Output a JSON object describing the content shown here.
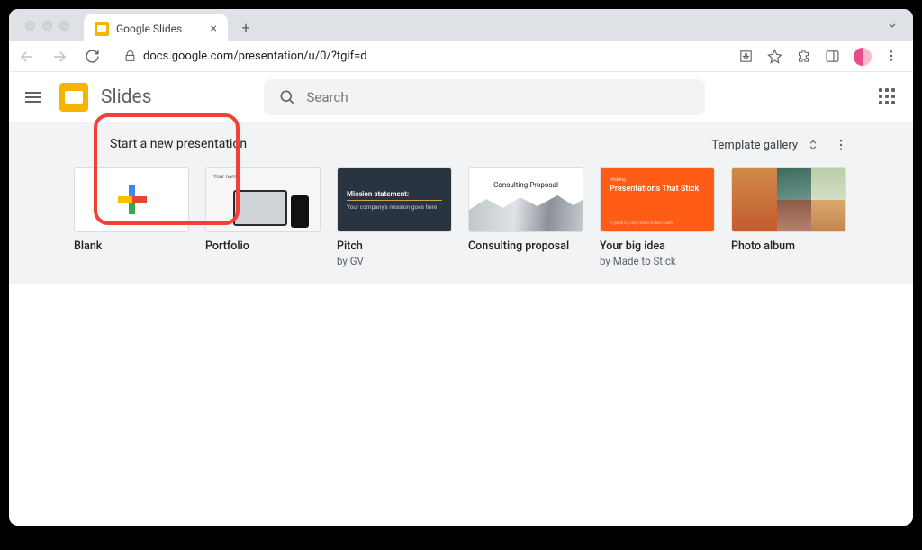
{
  "browser": {
    "tab_title": "Google Slides",
    "url": "docs.google.com/presentation/u/0/?tgif=d"
  },
  "app": {
    "name": "Slides",
    "search_placeholder": "Search"
  },
  "section": {
    "title": "Start a new presentation",
    "gallery_label": "Template gallery"
  },
  "templates": [
    {
      "title": "Blank",
      "subtitle": ""
    },
    {
      "title": "Portfolio",
      "subtitle": ""
    },
    {
      "title": "Pitch",
      "subtitle": "by GV",
      "thumb_heading": "Mission statement:",
      "thumb_sub": "Your company's mission goes here"
    },
    {
      "title": "Consulting proposal",
      "subtitle": "",
      "thumb_small": "——",
      "thumb_heading": "Consulting Proposal"
    },
    {
      "title": "Your big idea",
      "subtitle": "by Made to Stick",
      "thumb_small": "Making",
      "thumb_heading": "Presentations That Stick",
      "thumb_foot": "A guide by Chip Heath & Dan Heath"
    },
    {
      "title": "Photo album",
      "subtitle": ""
    }
  ]
}
